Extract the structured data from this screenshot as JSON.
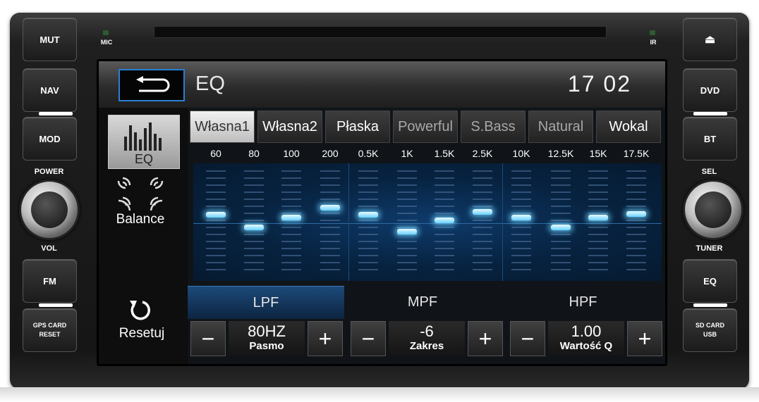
{
  "hardware": {
    "left_buttons": {
      "mut": "MUT",
      "nav": "NAV",
      "mod": "MOD",
      "fm": "FM",
      "gps": "GPS CARD\nRESET"
    },
    "left_labels": {
      "power": "POWER",
      "vol": "VOL",
      "mic": "MIC"
    },
    "right_buttons": {
      "eject": "⏏",
      "dvd": "DVD",
      "bt": "BT",
      "eq": "EQ",
      "sd": "SD CARD\nUSB"
    },
    "right_labels": {
      "sel": "SEL",
      "tuner": "TUNER",
      "ir": "IR"
    }
  },
  "header": {
    "title": "EQ",
    "clock": "17 02"
  },
  "sidebar": {
    "eq_label": "EQ",
    "balance_label": "Balance",
    "reset_label": "Resetuj"
  },
  "presets": [
    {
      "label": "Własna1",
      "state": "active"
    },
    {
      "label": "Własna2",
      "state": "normal"
    },
    {
      "label": "Płaska",
      "state": "normal"
    },
    {
      "label": "Powerful",
      "state": "dim"
    },
    {
      "label": "S.Bass",
      "state": "dim"
    },
    {
      "label": "Natural",
      "state": "dim"
    },
    {
      "label": "Wokal",
      "state": "normal"
    }
  ],
  "bands": [
    {
      "freq": "60",
      "level": 0.55
    },
    {
      "freq": "80",
      "level": 0.42
    },
    {
      "freq": "100",
      "level": 0.52
    },
    {
      "freq": "200",
      "level": 0.62
    },
    {
      "freq": "0.5K",
      "level": 0.55
    },
    {
      "freq": "1K",
      "level": 0.38
    },
    {
      "freq": "1.5K",
      "level": 0.49
    },
    {
      "freq": "2.5K",
      "level": 0.58
    },
    {
      "freq": "10K",
      "level": 0.52
    },
    {
      "freq": "12.5K",
      "level": 0.42
    },
    {
      "freq": "15K",
      "level": 0.52
    },
    {
      "freq": "17.5K",
      "level": 0.56
    }
  ],
  "filter_tabs": [
    {
      "label": "LPF",
      "active": true
    },
    {
      "label": "MPF",
      "active": false
    },
    {
      "label": "HPF",
      "active": false
    }
  ],
  "controls": [
    {
      "minus": "−",
      "value": "80HZ",
      "caption": "Pasmo",
      "plus": "+"
    },
    {
      "minus": "−",
      "value": "-6",
      "caption": "Zakres",
      "plus": "+"
    },
    {
      "minus": "−",
      "value": "1.00",
      "caption": "Wartość Q",
      "plus": "+"
    }
  ],
  "colors": {
    "accent": "#2a7fd4",
    "eq_glow": "#6ad3ff"
  }
}
